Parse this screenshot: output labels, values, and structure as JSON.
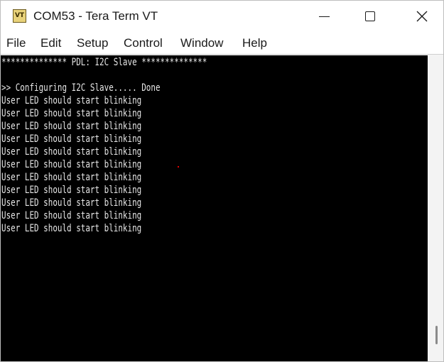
{
  "window": {
    "title": "COM53 - Tera Term VT",
    "icon_text": "VT",
    "icon_name": "tera-term-icon"
  },
  "menu": {
    "file": "File",
    "edit": "Edit",
    "setup": "Setup",
    "control": "Control",
    "window": "Window",
    "help": "Help"
  },
  "terminal": {
    "background": "#000000",
    "foreground": "#e6e6e6",
    "lines": [
      "************** PDL: I2C Slave **************",
      "",
      ">> Configuring I2C Slave..... Done",
      "User LED should start blinking",
      "User LED should start blinking",
      "User LED should start blinking",
      "User LED should start blinking",
      "User LED should start blinking",
      "User LED should start blinking",
      "User LED should start blinking",
      "User LED should start blinking",
      "User LED should start blinking",
      "User LED should start blinking",
      "User LED should start blinking"
    ]
  }
}
